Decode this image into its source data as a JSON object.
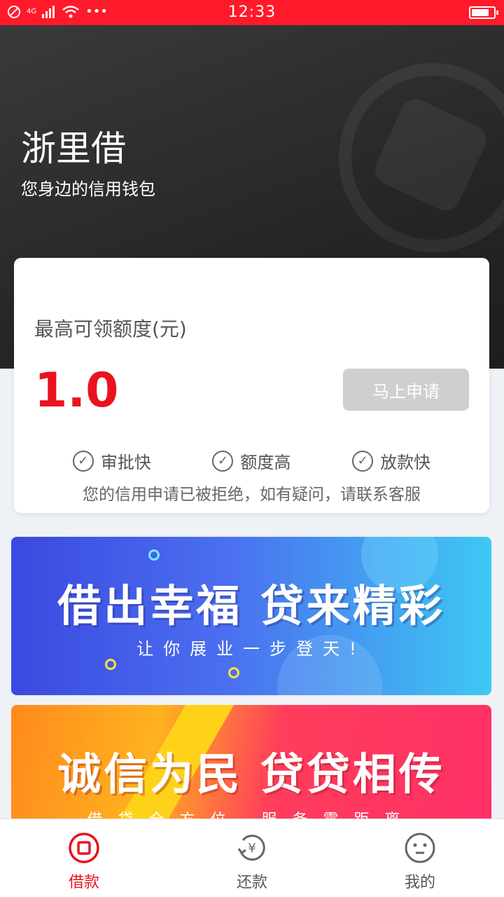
{
  "status_bar": {
    "time": "12:33",
    "network": "4G",
    "dots": "•••"
  },
  "hero": {
    "title": "浙里借",
    "subtitle": "您身边的信用钱包"
  },
  "credit_card": {
    "label": "最高可领额度(元)",
    "amount": "1.0",
    "apply_button": "马上申请",
    "features": [
      "审批快",
      "额度高",
      "放款快"
    ],
    "notice": "您的信用申请已被拒绝，如有疑问，请联系客服"
  },
  "banners": [
    {
      "headline": "借出幸福 贷来精彩",
      "tagline": "让你展业一步登天!"
    },
    {
      "headline": "诚信为民 贷贷相传",
      "tagline": "借贷全方位 服务零距离"
    }
  ],
  "tab_bar": {
    "items": [
      {
        "label": "借款",
        "active": true
      },
      {
        "label": "还款",
        "active": false
      },
      {
        "label": "我的",
        "active": false
      }
    ]
  },
  "colors": {
    "brand_red": "#e8131f",
    "status_bar": "#ff1a2b",
    "disabled_button": "#cfcfcf"
  }
}
